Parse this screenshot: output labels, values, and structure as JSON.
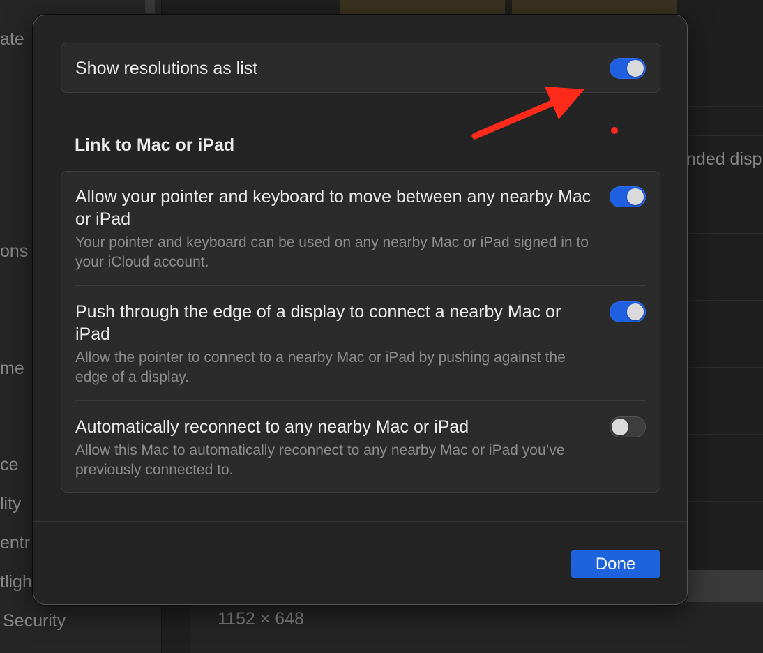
{
  "background": {
    "sidebar_items": [
      "ate",
      "ons",
      "me",
      "ce",
      "lity",
      "entr",
      "tligh",
      "Security"
    ],
    "right_text": "nded disp",
    "list_value": "1152 × 648"
  },
  "dialog": {
    "show_resolutions": {
      "label": "Show resolutions as list",
      "enabled": true
    },
    "section_heading": "Link to Mac or iPad",
    "link_options": [
      {
        "title": "Allow your pointer and keyboard to move between any nearby Mac or iPad",
        "description": "Your pointer and keyboard can be used on any nearby Mac or iPad signed in to your iCloud account.",
        "enabled": true
      },
      {
        "title": "Push through the edge of a display to connect a nearby Mac or iPad",
        "description": "Allow the pointer to connect to a nearby Mac or iPad by pushing against the edge of a display.",
        "enabled": true
      },
      {
        "title": "Automatically reconnect to any nearby Mac or iPad",
        "description": "Allow this Mac to automatically reconnect to any nearby Mac or iPad you’ve previously connected to.",
        "enabled": false
      }
    ],
    "done_label": "Done"
  },
  "colors": {
    "toggle_on": "#1f5fe0",
    "toggle_off": "#3e3e3e",
    "button_primary": "#1d63dd",
    "annotation": "#ff2a1a"
  },
  "icons": {
    "annotation_arrow": "red-arrow-icon",
    "annotation_dot": "red-dot-icon"
  }
}
